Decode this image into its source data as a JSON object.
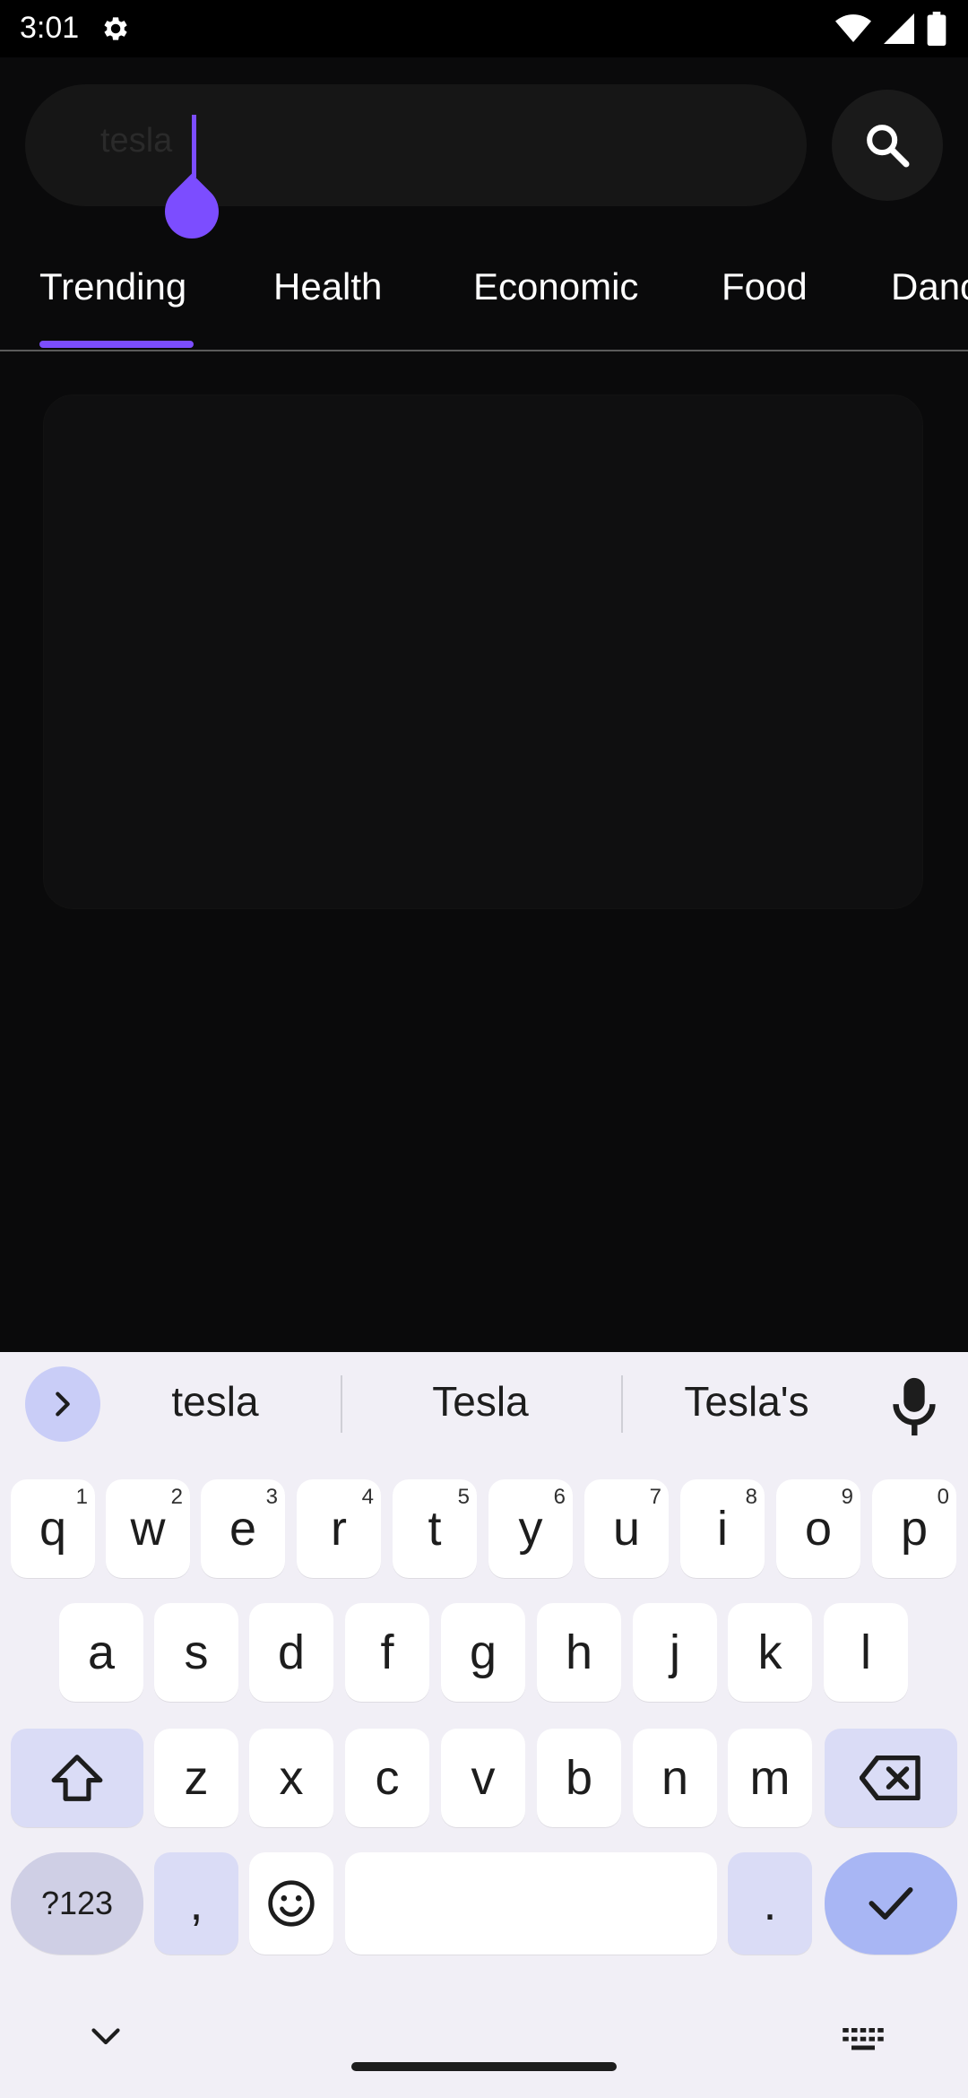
{
  "status_bar": {
    "time": "3:01",
    "icons": [
      "settings-gear-icon",
      "wifi-icon",
      "cell-signal-icon",
      "battery-icon"
    ]
  },
  "search": {
    "value": "tesla"
  },
  "tabs": [
    "Trending",
    "Health",
    "Economic",
    "Food",
    "Danc"
  ],
  "active_tab": "Trending",
  "keyboard": {
    "suggestions": [
      "tesla",
      "Tesla",
      "Tesla's"
    ],
    "row1": [
      {
        "key": "q",
        "hint": "1"
      },
      {
        "key": "w",
        "hint": "2"
      },
      {
        "key": "e",
        "hint": "3"
      },
      {
        "key": "r",
        "hint": "4"
      },
      {
        "key": "t",
        "hint": "5"
      },
      {
        "key": "y",
        "hint": "6"
      },
      {
        "key": "u",
        "hint": "7"
      },
      {
        "key": "i",
        "hint": "8"
      },
      {
        "key": "o",
        "hint": "9"
      },
      {
        "key": "p",
        "hint": "0"
      }
    ],
    "row2": [
      "a",
      "s",
      "d",
      "f",
      "g",
      "h",
      "j",
      "k",
      "l"
    ],
    "row3": [
      "z",
      "x",
      "c",
      "v",
      "b",
      "n",
      "m"
    ],
    "num_key": "?123",
    "comma": ",",
    "period": "."
  },
  "colors": {
    "accent": "#7c4dff",
    "background": "#0a0a0b",
    "keyboard_bg": "#f1eff6"
  }
}
